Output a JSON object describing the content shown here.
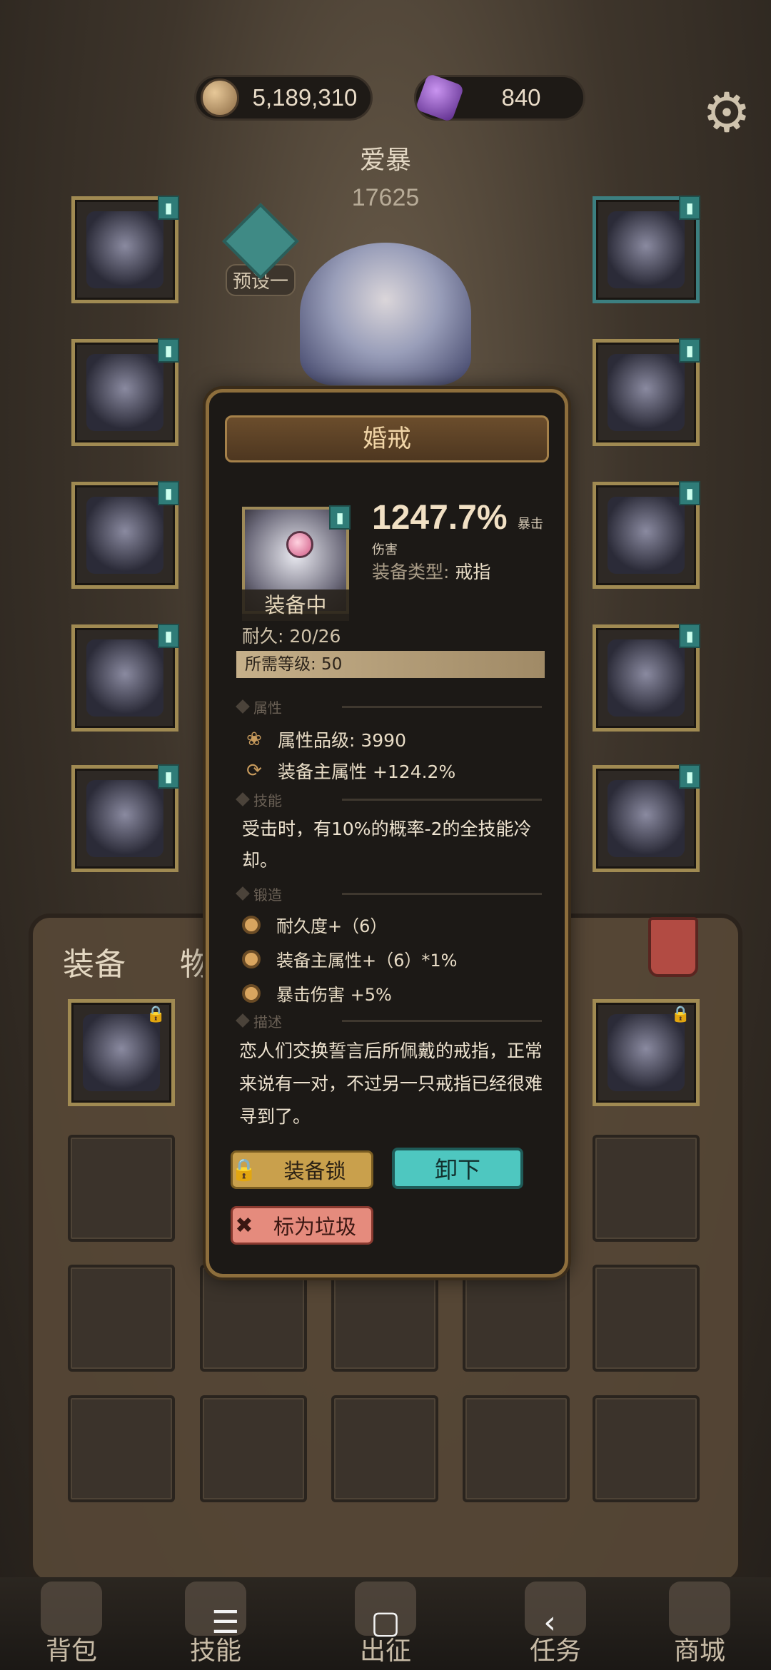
{
  "currencies": {
    "gold": "5,189,310",
    "gems": "840"
  },
  "hero": {
    "name": "爱暴",
    "power": "17625",
    "preset_label": "预设一"
  },
  "bag_tabs": {
    "equipment": "装备",
    "items": "物品"
  },
  "popup": {
    "title": "婚戒",
    "main_stat_value": "1247.7%",
    "main_stat_suffix": "暴击",
    "main_stat_line2": "伤害",
    "equip_type_label": "装备类型:",
    "equip_type_value": "戒指",
    "equipped_label": "装备中",
    "durability": "耐久: 20/26",
    "required_level": "所需等级: 50",
    "sections": {
      "attributes": "属性",
      "skills": "技能",
      "forging": "锻造",
      "description": "描述"
    },
    "attribute_grade": "属性品级: 3990",
    "main_attribute_bonus": "装备主属性 +124.2%",
    "skill_text": "受击时，有10%的概率-2的全技能冷却。",
    "forge_effects": [
      "耐久度+（6）",
      "装备主属性+（6）*1%",
      "暴击伤害 +5%"
    ],
    "description_text": "恋人们交换誓言后所佩戴的戒指，正常来说有一对，不过另一只戒指已经很难寻到了。",
    "buttons": {
      "lock": "装备锁",
      "unequip": "卸下",
      "mark_junk": "标为垃圾"
    }
  },
  "bottom_nav": [
    "背包",
    "技能",
    "出征",
    "任务",
    "商城"
  ],
  "system_nav": {
    "menu": "☰",
    "home": "▢",
    "back": "‹"
  },
  "colors": {
    "accent_teal": "#4ec7c0",
    "gold_border": "#a08a52",
    "lock_button": "#c9a04c",
    "junk_button": "#e58b7d"
  }
}
